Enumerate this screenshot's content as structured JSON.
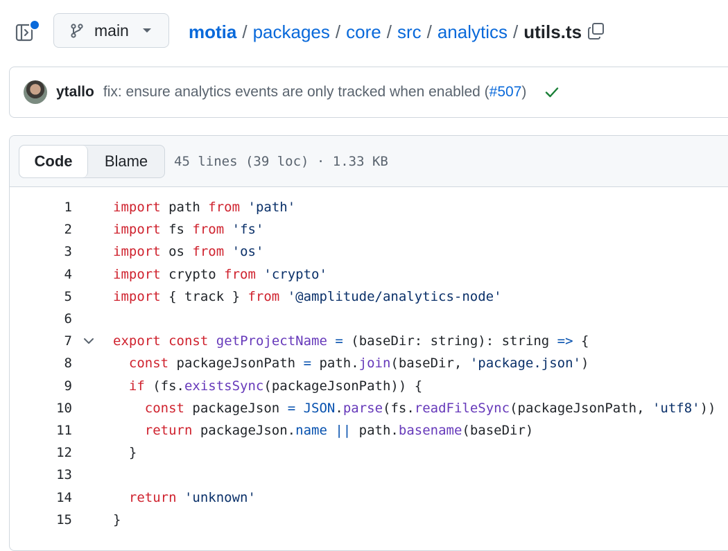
{
  "branch": {
    "name": "main"
  },
  "breadcrumb": {
    "repo": "motia",
    "dirs": [
      "packages",
      "core",
      "src",
      "analytics"
    ],
    "separator": "/",
    "file": "utils.ts"
  },
  "commit": {
    "author": "ytallo",
    "message_prefix": "fix: ensure analytics events are only tracked when enabled (",
    "pr_link": "#507",
    "message_suffix": ")",
    "status": "success"
  },
  "code_view": {
    "tabs": [
      "Code",
      "Blame"
    ],
    "active_tab": "Code",
    "file_info": "45 lines (39 loc) · 1.33 KB"
  },
  "colors": {
    "keyword": "#cf222e",
    "string": "#0a3069",
    "function": "#6639ba",
    "constant": "#0550ae",
    "link": "#0969da",
    "success": "#1a7f37"
  },
  "lines": [
    {
      "num": "1",
      "tokens": [
        [
          "kw",
          "import"
        ],
        [
          "plain",
          " path "
        ],
        [
          "kw",
          "from"
        ],
        [
          "plain",
          " "
        ],
        [
          "str",
          "'path'"
        ]
      ]
    },
    {
      "num": "2",
      "tokens": [
        [
          "kw",
          "import"
        ],
        [
          "plain",
          " fs "
        ],
        [
          "kw",
          "from"
        ],
        [
          "plain",
          " "
        ],
        [
          "str",
          "'fs'"
        ]
      ]
    },
    {
      "num": "3",
      "tokens": [
        [
          "kw",
          "import"
        ],
        [
          "plain",
          " os "
        ],
        [
          "kw",
          "from"
        ],
        [
          "plain",
          " "
        ],
        [
          "str",
          "'os'"
        ]
      ]
    },
    {
      "num": "4",
      "tokens": [
        [
          "kw",
          "import"
        ],
        [
          "plain",
          " crypto "
        ],
        [
          "kw",
          "from"
        ],
        [
          "plain",
          " "
        ],
        [
          "str",
          "'crypto'"
        ]
      ]
    },
    {
      "num": "5",
      "tokens": [
        [
          "kw",
          "import"
        ],
        [
          "plain",
          " { track } "
        ],
        [
          "kw",
          "from"
        ],
        [
          "plain",
          " "
        ],
        [
          "str",
          "'@amplitude/analytics-node'"
        ]
      ]
    },
    {
      "num": "6",
      "tokens": []
    },
    {
      "num": "7",
      "fold": true,
      "tokens": [
        [
          "kw",
          "export"
        ],
        [
          "plain",
          " "
        ],
        [
          "kw",
          "const"
        ],
        [
          "plain",
          " "
        ],
        [
          "fn",
          "getProjectName"
        ],
        [
          "plain",
          " "
        ],
        [
          "const",
          "="
        ],
        [
          "plain",
          " (baseDir: string): string "
        ],
        [
          "const",
          "=>"
        ],
        [
          "plain",
          " {"
        ]
      ]
    },
    {
      "num": "8",
      "tokens": [
        [
          "plain",
          "  "
        ],
        [
          "kw",
          "const"
        ],
        [
          "plain",
          " packageJsonPath "
        ],
        [
          "const",
          "="
        ],
        [
          "plain",
          " path."
        ],
        [
          "fn",
          "join"
        ],
        [
          "plain",
          "(baseDir, "
        ],
        [
          "str",
          "'package.json'"
        ],
        [
          "plain",
          ")"
        ]
      ]
    },
    {
      "num": "9",
      "tokens": [
        [
          "plain",
          "  "
        ],
        [
          "kw",
          "if"
        ],
        [
          "plain",
          " (fs."
        ],
        [
          "fn",
          "existsSync"
        ],
        [
          "plain",
          "(packageJsonPath)) {"
        ]
      ]
    },
    {
      "num": "10",
      "tokens": [
        [
          "plain",
          "    "
        ],
        [
          "kw",
          "const"
        ],
        [
          "plain",
          " packageJson "
        ],
        [
          "const",
          "="
        ],
        [
          "plain",
          " "
        ],
        [
          "const",
          "JSON"
        ],
        [
          "plain",
          "."
        ],
        [
          "fn",
          "parse"
        ],
        [
          "plain",
          "(fs."
        ],
        [
          "fn",
          "readFileSync"
        ],
        [
          "plain",
          "(packageJsonPath, "
        ],
        [
          "str",
          "'utf8'"
        ],
        [
          "plain",
          "))"
        ]
      ]
    },
    {
      "num": "11",
      "tokens": [
        [
          "plain",
          "    "
        ],
        [
          "kw",
          "return"
        ],
        [
          "plain",
          " packageJson."
        ],
        [
          "const",
          "name"
        ],
        [
          "plain",
          " "
        ],
        [
          "const",
          "||"
        ],
        [
          "plain",
          " path."
        ],
        [
          "fn",
          "basename"
        ],
        [
          "plain",
          "(baseDir)"
        ]
      ]
    },
    {
      "num": "12",
      "tokens": [
        [
          "plain",
          "  }"
        ]
      ]
    },
    {
      "num": "13",
      "tokens": []
    },
    {
      "num": "14",
      "tokens": [
        [
          "plain",
          "  "
        ],
        [
          "kw",
          "return"
        ],
        [
          "plain",
          " "
        ],
        [
          "str",
          "'unknown'"
        ]
      ]
    },
    {
      "num": "15",
      "tokens": [
        [
          "plain",
          "}"
        ]
      ]
    }
  ]
}
